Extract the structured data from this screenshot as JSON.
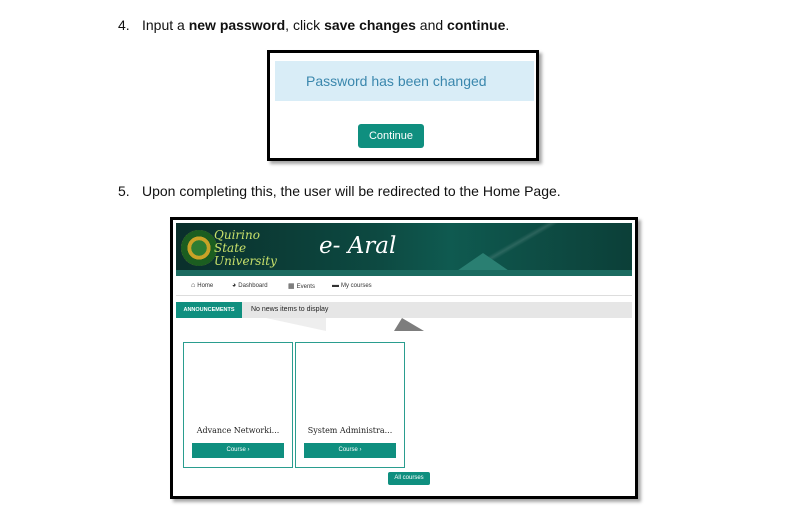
{
  "step4": {
    "number": "4.",
    "parts": [
      "Input a ",
      "new password",
      ", click ",
      "save changes",
      " and ",
      "continue",
      "."
    ]
  },
  "screenshot1": {
    "alert_text": "Password has been changed",
    "continue_label": "Continue"
  },
  "step5": {
    "number": "5.",
    "text": "Upon completing this, the user will be redirected to the Home Page."
  },
  "screenshot2": {
    "university_lines": [
      "Quirino",
      "State",
      "University"
    ],
    "site_title": "e- Aral",
    "nav": [
      {
        "icon": "home-icon",
        "label": "Home"
      },
      {
        "icon": "dashboard-icon",
        "label": "Dashboard"
      },
      {
        "icon": "calendar-icon",
        "label": "Events"
      },
      {
        "icon": "briefcase-icon",
        "label": "My courses"
      }
    ],
    "announcements_label": "ANNOUNCEMENTS",
    "announcements_text": "No news items to display",
    "courses": [
      {
        "title": "Advance Networki...",
        "button": "Course ›"
      },
      {
        "title": "System Administra...",
        "button": "Course ›"
      }
    ],
    "all_courses_label": "All courses",
    "colors": {
      "accent": "#0f8f7f",
      "banner": "#0d4a42",
      "alert_bg": "#d9edf7",
      "alert_text": "#3a87ad"
    }
  }
}
